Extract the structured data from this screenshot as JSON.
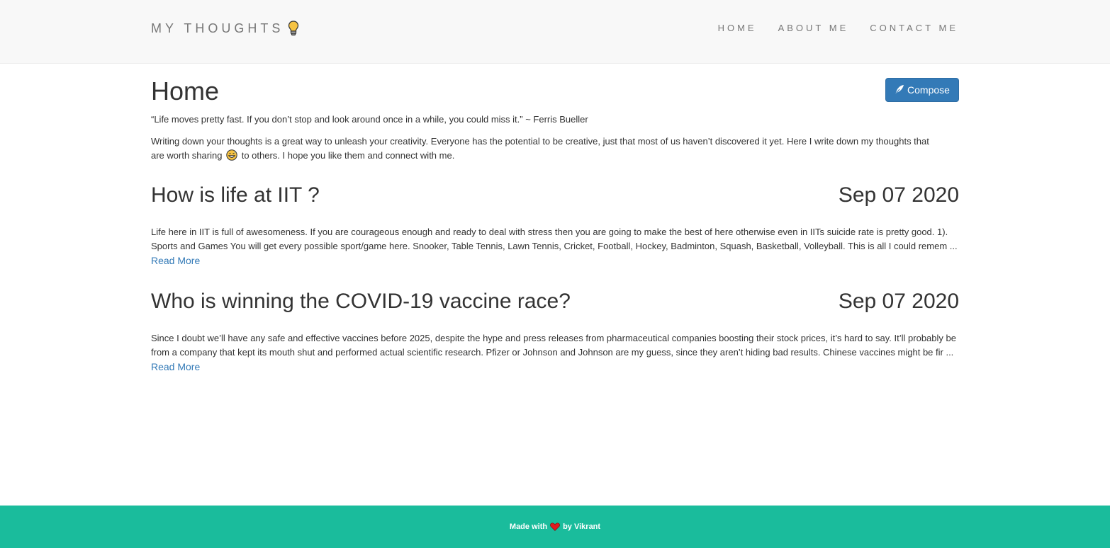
{
  "navbar": {
    "brand": "MY THOUGHTS",
    "brand_icon": "lightbulb-icon",
    "links": [
      "HOME",
      "ABOUT ME",
      "CONTACT ME"
    ]
  },
  "header": {
    "title": "Home",
    "compose_label": "Compose",
    "compose_icon": "pen-icon"
  },
  "intro": {
    "quote": "“Life moves pretty fast. If you don’t stop and look around once in a while, you could miss it.” ~ Ferris Bueller",
    "text_before_emoji": "Writing down your thoughts is a great way to unleash your creativity. Everyone has the potential to be creative, just that most of us haven’t discovered it yet. Here I write down my thoughts that are worth sharing",
    "emoji": "grinning-sweat-emoji",
    "text_after_emoji": "to others. I hope you like them and connect with me."
  },
  "posts": [
    {
      "title": "How is life at IIT ?",
      "date": "Sep 07 2020",
      "excerpt": "Life here in IIT is full of awesomeness. If you are courageous enough and ready to deal with stress then you are going to make the best of here otherwise even in IITs suicide rate is pretty good. 1). Sports and Games You will get every possible sport/game here. Snooker, Table Tennis, Lawn Tennis, Cricket, Football, Hockey, Badminton, Squash, Basketball, Volleyball. This is all I could remem ...",
      "read_more": "Read More"
    },
    {
      "title": "Who is winning the COVID-19 vaccine race?",
      "date": "Sep 07 2020",
      "excerpt": "Since I doubt we’ll have any safe and effective vaccines before 2025, despite the hype and press releases from pharmaceutical companies boosting their stock prices, it’s hard to say. It’ll probably be from a company that kept its mouth shut and performed actual scientific research. Pfizer or Johnson and Johnson are my guess, since they aren’t hiding bad results. Chinese vaccines might be fir ...",
      "read_more": "Read More"
    }
  ],
  "footer": {
    "made_with": "Made with",
    "heart_icon": "heart-icon",
    "by": "by Vikrant"
  },
  "colors": {
    "navbar_bg": "#f8f8f8",
    "primary_button": "#337ab7",
    "link": "#337ab7",
    "footer_bg": "#1abc9c"
  }
}
